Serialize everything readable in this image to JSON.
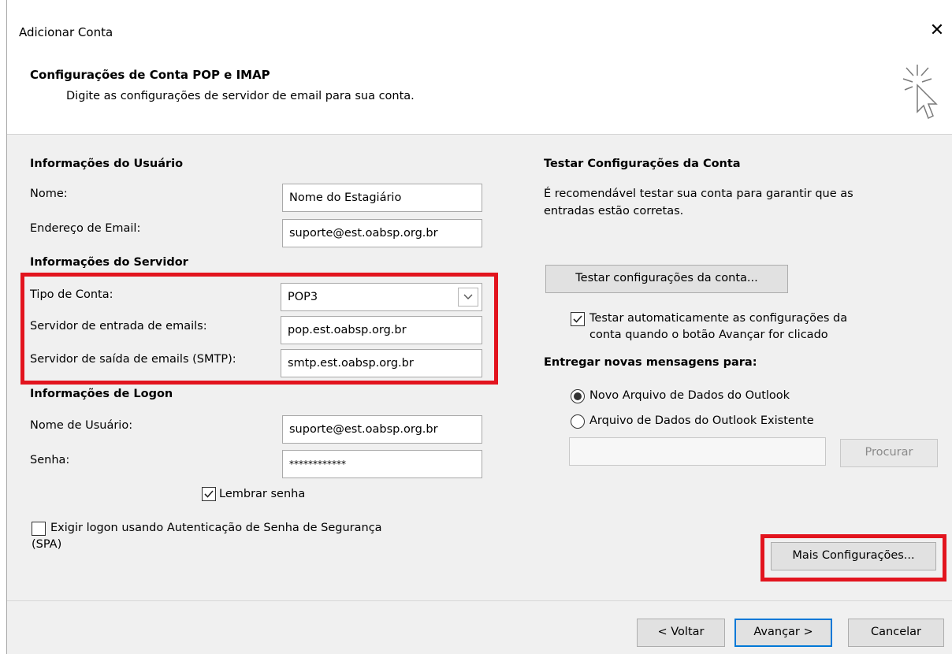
{
  "window": {
    "title": "Adicionar Conta",
    "close_glyph": "✕",
    "header_title": "Configurações de Conta POP e IMAP",
    "header_subtitle": "Digite as configurações de servidor de email para sua conta.",
    "header_icon": "cursor-sparkle-icon"
  },
  "user_info": {
    "heading": "Informações do Usuário",
    "name_label": "Nome:",
    "name_value": "Nome do Estagiário",
    "email_label": "Endereço de Email:",
    "email_value": "suporte@est.oabsp.org.br"
  },
  "server_info": {
    "heading": "Informações do Servidor",
    "account_type_label": "Tipo de Conta:",
    "account_type_value": "POP3",
    "incoming_label": "Servidor de entrada de emails:",
    "incoming_value": "pop.est.oabsp.org.br",
    "outgoing_label": "Servidor de saída de emails (SMTP):",
    "outgoing_value": "smtp.est.oabsp.org.br"
  },
  "logon_info": {
    "heading": "Informações de Logon",
    "username_label": "Nome de Usuário:",
    "username_value": "suporte@est.oabsp.org.br",
    "password_label": "Senha:",
    "password_value": "************",
    "remember_label": "Lembrar senha",
    "remember_checked": true,
    "spa_label_line1": "Exigir logon usando Autenticação de Senha de Segurança",
    "spa_label_line2": "(SPA)",
    "spa_checked": false
  },
  "test_settings": {
    "heading": "Testar Configurações da Conta",
    "desc_line1": "É recomendável testar sua conta para garantir que as",
    "desc_line2": "entradas estão corretas.",
    "test_button": "Testar configurações da conta...",
    "auto_test_line1": "Testar automaticamente as configurações da",
    "auto_test_line2": "conta quando o botão Avançar for clicado",
    "auto_test_checked": true
  },
  "deliver": {
    "heading": "Entregar novas mensagens para:",
    "option_new": "Novo Arquivo de Dados do Outlook",
    "option_existing": "Arquivo de Dados do Outlook Existente",
    "selected": "new",
    "path_value": "",
    "browse_button": "Procurar"
  },
  "more_settings_button": "Mais Configurações...",
  "footer": {
    "back_button": "< Voltar",
    "next_button": "Avançar >",
    "cancel_button": "Cancelar"
  },
  "highlight_color": "#e2141e",
  "accent_color": "#0078d7"
}
